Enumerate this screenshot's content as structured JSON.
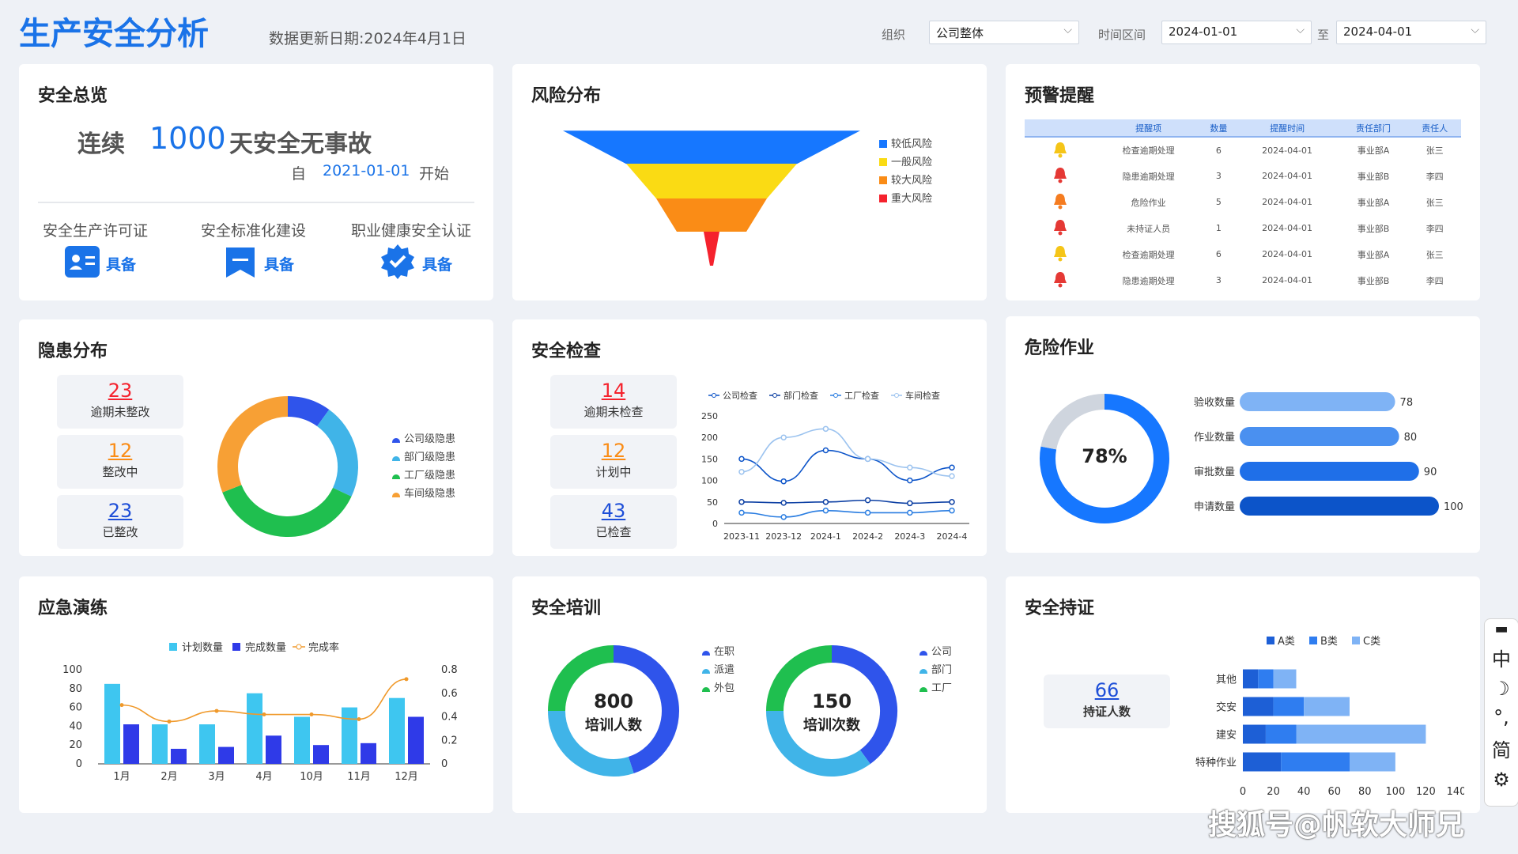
{
  "header": {
    "title": "生产安全分析",
    "update_text": "数据更新日期:2024年4月1日",
    "org_label": "组织",
    "org_value": "公司整体",
    "time_label": "时间区间",
    "start_date": "2024-01-01",
    "to_label": "至",
    "end_date": "2024-04-01"
  },
  "overview": {
    "title": "安全总览",
    "prefix": "连续",
    "days": "1000",
    "suffix": "天安全无事故",
    "from_label": "自",
    "from_date": "2021-01-01",
    "start_label": "开始",
    "certs": [
      {
        "name": "安全生产许可证",
        "status": "具备",
        "icon": "id-card-icon"
      },
      {
        "name": "安全标准化建设",
        "status": "具备",
        "icon": "bookmark-icon"
      },
      {
        "name": "职业健康安全认证",
        "status": "具备",
        "icon": "verified-badge-icon"
      }
    ]
  },
  "risk": {
    "title": "风险分布",
    "legend": [
      {
        "label": "较低风险",
        "color": "#1677ff"
      },
      {
        "label": "一般风险",
        "color": "#fadb14"
      },
      {
        "label": "较大风险",
        "color": "#fa8c16"
      },
      {
        "label": "重大风险",
        "color": "#f5222d"
      }
    ]
  },
  "warning": {
    "title": "预警提醒",
    "columns": [
      "提醒项",
      "数量",
      "提醒时间",
      "责任部门",
      "责任人"
    ],
    "rows": [
      {
        "level": "yellow",
        "item": "检查逾期处理",
        "qty": "6",
        "time": "2024-04-01",
        "dept": "事业部A",
        "person": "张三"
      },
      {
        "level": "red",
        "item": "隐患逾期处理",
        "qty": "3",
        "time": "2024-04-01",
        "dept": "事业部B",
        "person": "李四"
      },
      {
        "level": "orange",
        "item": "危险作业",
        "qty": "5",
        "time": "2024-04-01",
        "dept": "事业部A",
        "person": "张三"
      },
      {
        "level": "red",
        "item": "未持证人员",
        "qty": "1",
        "time": "2024-04-01",
        "dept": "事业部B",
        "person": "李四"
      },
      {
        "level": "yellow",
        "item": "检查逾期处理",
        "qty": "6",
        "time": "2024-04-01",
        "dept": "事业部A",
        "person": "张三"
      },
      {
        "level": "red",
        "item": "隐患逾期处理",
        "qty": "3",
        "time": "2024-04-01",
        "dept": "事业部B",
        "person": "李四"
      }
    ]
  },
  "hazard": {
    "title": "隐患分布",
    "stats": [
      {
        "value": "23",
        "label": "逾期未整改",
        "color": "#f5222d"
      },
      {
        "value": "12",
        "label": "整改中",
        "color": "#fa8c16"
      },
      {
        "value": "23",
        "label": "已整改",
        "color": "#1d4ed8"
      }
    ]
  },
  "inspection": {
    "title": "安全检查",
    "stats": [
      {
        "value": "14",
        "label": "逾期未检查",
        "color": "#f5222d"
      },
      {
        "value": "12",
        "label": "计划中",
        "color": "#fa8c16"
      },
      {
        "value": "43",
        "label": "已检查",
        "color": "#1d4ed8"
      }
    ]
  },
  "danger": {
    "title": "危险作业",
    "rate_text": "78%"
  },
  "drill": {
    "title": "应急演练"
  },
  "training": {
    "title": "安全培训",
    "donut1": {
      "value": "800",
      "label": "培训人数",
      "legend": [
        "在职",
        "派遣",
        "外包"
      ]
    },
    "donut2": {
      "value": "150",
      "label": "培训次数",
      "legend": [
        "公司",
        "部门",
        "工厂"
      ]
    }
  },
  "certificate": {
    "title": "安全持证",
    "count": "66",
    "count_label": "持证人数"
  },
  "toolbar": [
    "中",
    "☽",
    "°,",
    "简",
    "⚙"
  ],
  "watermark": "搜狐号@帆软大师兄",
  "chart_data": [
    {
      "type": "funnel",
      "categories": [
        "较低风险",
        "一般风险",
        "较大风险",
        "重大风险"
      ],
      "values": [
        4,
        3,
        2,
        1
      ]
    },
    {
      "type": "pie",
      "categories": [
        "公司级隐患",
        "部门级隐患",
        "工厂级隐患",
        "车间级隐患"
      ],
      "values": [
        10,
        22,
        37,
        31
      ],
      "colors": [
        "#2f54eb",
        "#40b4e8",
        "#1fbf4f",
        "#f7a035"
      ]
    },
    {
      "type": "line",
      "x": [
        "2023-11",
        "2023-12",
        "2024-1",
        "2024-2",
        "2024-3",
        "2024-4"
      ],
      "ylim": [
        0,
        250
      ],
      "yticks": [
        0,
        50,
        100,
        150,
        200,
        250
      ],
      "series": [
        {
          "name": "公司检查",
          "values": [
            150,
            98,
            170,
            150,
            100,
            130
          ],
          "color": "#0c54c9"
        },
        {
          "name": "部门检查",
          "values": [
            50,
            48,
            50,
            54,
            47,
            50
          ],
          "color": "#0c3fa3"
        },
        {
          "name": "工厂检查",
          "values": [
            25,
            15,
            30,
            25,
            25,
            30
          ],
          "color": "#2a7de1"
        },
        {
          "name": "车间检查",
          "values": [
            120,
            200,
            220,
            150,
            130,
            110
          ],
          "color": "#9cc3ef"
        }
      ]
    },
    {
      "type": "bar",
      "orientation": "horizontal",
      "categories": [
        "验收数量",
        "作业数量",
        "审批数量",
        "申请数量"
      ],
      "values": [
        78,
        80,
        90,
        100
      ],
      "donut_value": 78
    },
    {
      "type": "bar",
      "categories": [
        "1月",
        "2月",
        "3月",
        "4月",
        "10月",
        "11月",
        "12月"
      ],
      "series": [
        {
          "name": "计划数量",
          "values": [
            85,
            42,
            42,
            75,
            50,
            60,
            70
          ],
          "color": "#3ec6f0"
        },
        {
          "name": "完成数量",
          "values": [
            42,
            16,
            18,
            30,
            20,
            22,
            50
          ],
          "color": "#2f3ae8"
        },
        {
          "name": "完成率",
          "values": [
            0.5,
            0.36,
            0.45,
            0.42,
            0.42,
            0.38,
            0.72
          ],
          "color": "#f0992a",
          "axis": "right"
        }
      ],
      "ylim": [
        0,
        100
      ],
      "yticks": [
        0,
        20,
        40,
        60,
        80,
        100
      ],
      "y2lim": [
        0,
        0.8
      ],
      "y2ticks": [
        0,
        0.2,
        0.4,
        0.6,
        0.8
      ]
    },
    {
      "type": "pie",
      "categories": [
        "在职",
        "派遣",
        "外包"
      ],
      "values": [
        45,
        30,
        25
      ],
      "colors": [
        "#2f54eb",
        "#40b4e8",
        "#1fbf4f"
      ]
    },
    {
      "type": "pie",
      "categories": [
        "公司",
        "部门",
        "工厂"
      ],
      "values": [
        40,
        35,
        25
      ],
      "colors": [
        "#2f54eb",
        "#40b4e8",
        "#1fbf4f"
      ]
    },
    {
      "type": "bar",
      "orientation": "horizontal",
      "stacked": true,
      "categories": [
        "其他",
        "交安",
        "建安",
        "特种作业"
      ],
      "xlim": [
        0,
        140
      ],
      "xticks": [
        0,
        20,
        40,
        60,
        80,
        100,
        120,
        140
      ],
      "series": [
        {
          "name": "A类",
          "values": [
            10,
            20,
            15,
            25
          ],
          "color": "#1d5fd6"
        },
        {
          "name": "B类",
          "values": [
            10,
            20,
            20,
            45
          ],
          "color": "#2f7df0"
        },
        {
          "name": "C类",
          "values": [
            15,
            30,
            85,
            30
          ],
          "color": "#7fb3f5"
        }
      ]
    }
  ]
}
